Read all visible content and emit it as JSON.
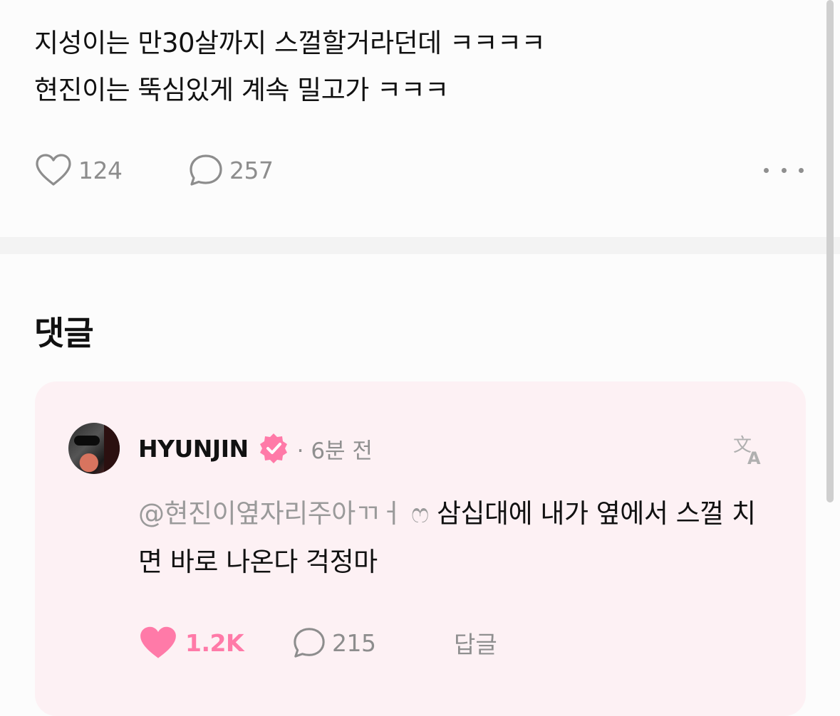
{
  "post": {
    "lines": [
      "지성이는 만30살까지 스껄할거라던데 ㅋㅋㅋㅋ",
      "현진이는 뚝심있게 계속 밀고가 ㅋㅋㅋ"
    ],
    "like_count": "124",
    "comment_count": "257"
  },
  "comments_section": {
    "title": "댓글"
  },
  "comment": {
    "author": "HYUNJIN",
    "time": "· 6분 전",
    "mention": "@현진이옆자리주아ㄲㅓ ෆ",
    "text": " 삼십대에 내가 옆에서 스껄 치면 바로 나온다 걱정마",
    "like_count": "1.2K",
    "reply_count": "215",
    "reply_label": "답글"
  },
  "icons": {
    "heart_outline": "heart-icon",
    "heart_filled": "heart-filled-icon",
    "comment": "comment-bubble-icon",
    "more": "more-horizontal-icon",
    "verified": "verified-badge-icon",
    "translate": "translate-icon"
  },
  "colors": {
    "accent_pink": "#ff7aa8",
    "card_background": "#fdf1f4",
    "muted_text": "#8d8d8d"
  }
}
